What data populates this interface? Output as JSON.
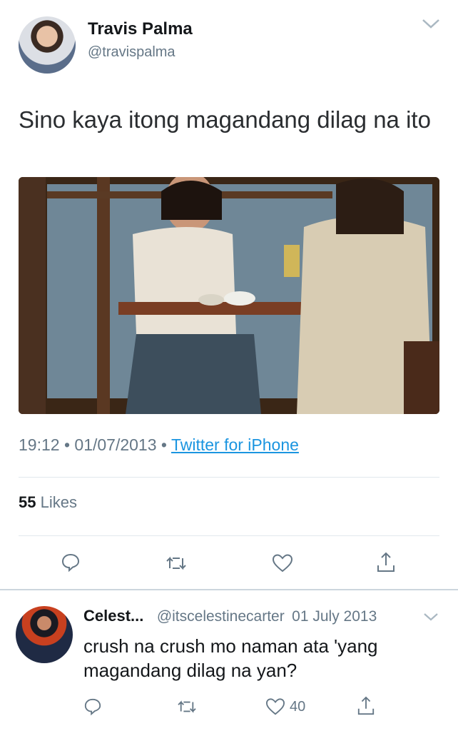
{
  "tweet": {
    "author_name": "Travis Palma",
    "author_handle": "@travispalma",
    "text": "Sino kaya itong magandang dilag na ito",
    "time": "19:12",
    "date": "01/07/2013",
    "source": "Twitter for iPhone",
    "likes_count": "55",
    "likes_label": "Likes"
  },
  "reply": {
    "author_name": "Celest...",
    "author_handle": "@itscelestinecarter",
    "date": "01 July 2013",
    "text": "crush na crush mo naman ata 'yang magandang dilag na yan?",
    "like_count": "40"
  },
  "icons": {
    "reply": "speech-bubble-icon",
    "retweet": "retweet-icon",
    "like": "heart-icon",
    "share": "share-icon",
    "menu": "chevron-down-icon"
  },
  "colors": {
    "link": "#1b95e0",
    "muted": "#657786",
    "text": "#14171a"
  }
}
